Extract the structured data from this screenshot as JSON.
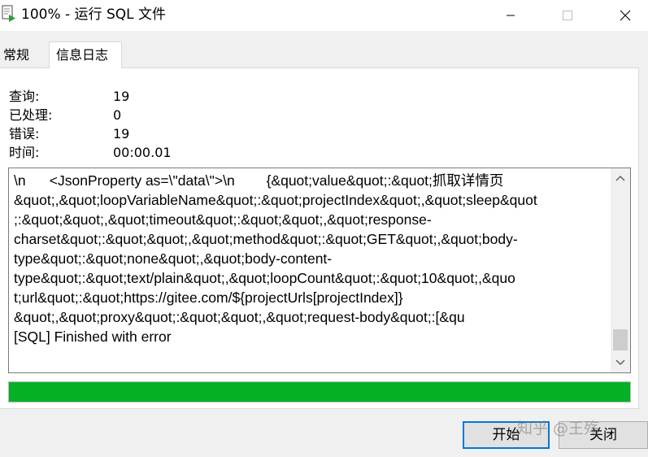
{
  "window": {
    "title": "100% - 运行 SQL 文件",
    "icon": "navicat-run-sql-icon",
    "controls": [
      "minimize-icon",
      "maximize-icon",
      "close-icon"
    ]
  },
  "tabs": [
    {
      "label": "常规",
      "active": false
    },
    {
      "label": "信息日志",
      "active": true
    }
  ],
  "stats": [
    {
      "label": "查询:",
      "value": "19"
    },
    {
      "label": "已处理:",
      "value": "0"
    },
    {
      "label": "错误:",
      "value": "19"
    },
    {
      "label": "时间:",
      "value": "00:00.01"
    }
  ],
  "log": {
    "lines": [
      "\\n      <JsonProperty as=\\\"data\\\">\\n        {&quot;value&quot;:&quot;抓取详情页",
      "&quot;,&quot;loopVariableName&quot;:&quot;projectIndex&quot;,&quot;sleep&quot",
      ";:&quot;&quot;,&quot;timeout&quot;:&quot;&quot;,&quot;response-",
      "charset&quot;:&quot;&quot;,&quot;method&quot;:&quot;GET&quot;,&quot;body-",
      "type&quot;:&quot;none&quot;,&quot;body-content-",
      "type&quot;:&quot;text/plain&quot;,&quot;loopCount&quot;:&quot;10&quot;,&quo",
      "t;url&quot;:&quot;https://gitee.com/${projectUrls[projectIndex]}",
      "&quot;,&quot;proxy&quot;:&quot;&quot;,&quot;request-body&quot;:[&qu",
      "[SQL] Finished with error"
    ]
  },
  "progress": {
    "percent": 100,
    "color": "#06b025"
  },
  "buttons": {
    "start": "开始",
    "close": "关闭"
  },
  "watermark": "知乎 @王殇",
  "colors": {
    "accent": "#0078d7",
    "progress": "#06b025",
    "dialog_bg": "#f0f0f0"
  }
}
